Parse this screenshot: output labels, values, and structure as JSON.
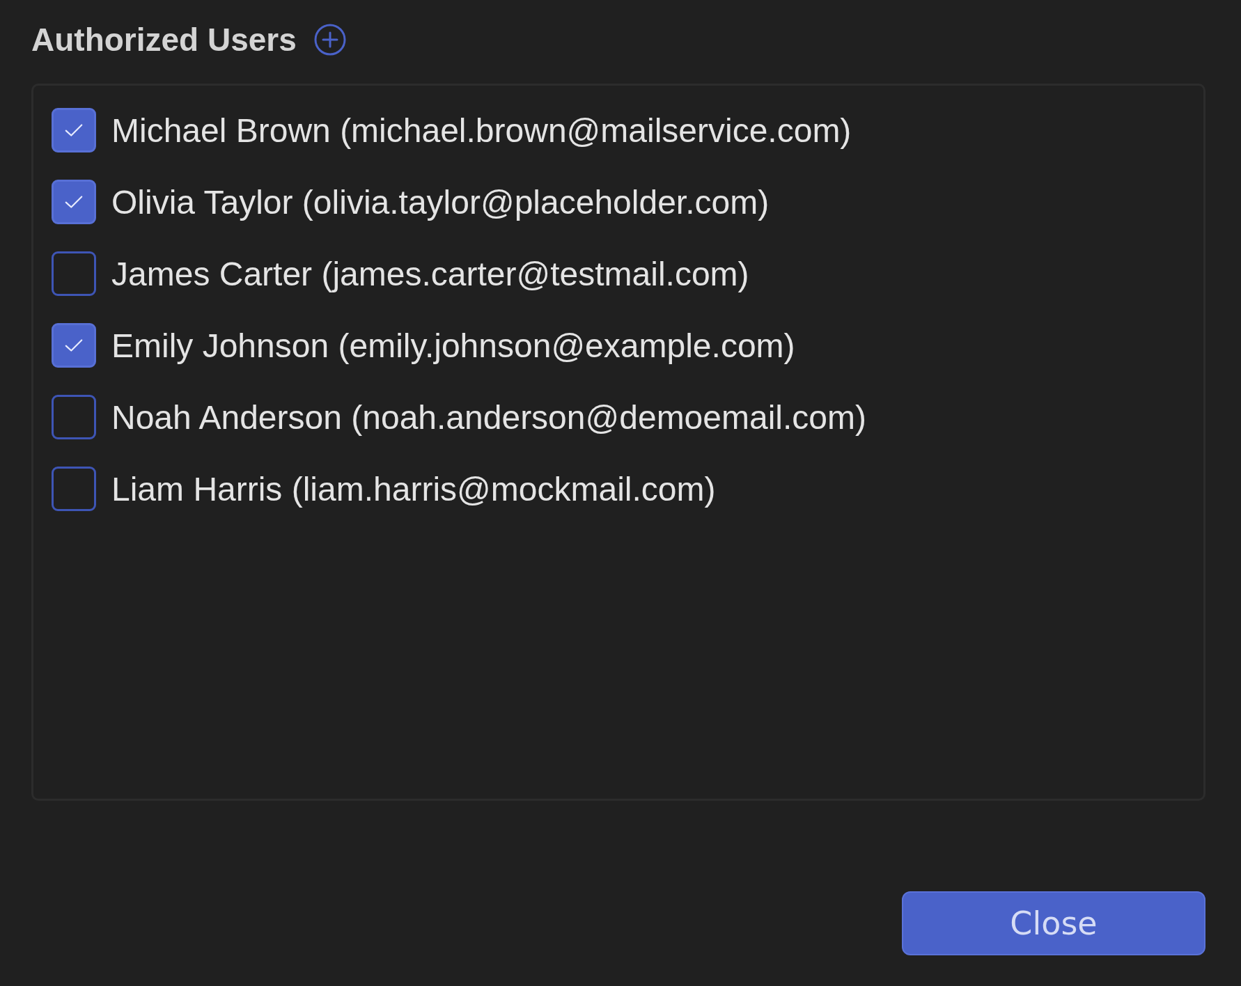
{
  "header": {
    "title": "Authorized Users"
  },
  "users": [
    {
      "label": "Michael Brown (michael.brown@mailservice.com)",
      "checked": true
    },
    {
      "label": "Olivia Taylor (olivia.taylor@placeholder.com)",
      "checked": true
    },
    {
      "label": "James Carter (james.carter@testmail.com)",
      "checked": false
    },
    {
      "label": "Emily Johnson (emily.johnson@example.com)",
      "checked": true
    },
    {
      "label": "Noah Anderson (noah.anderson@demoemail.com)",
      "checked": false
    },
    {
      "label": "Liam Harris (liam.harris@mockmail.com)",
      "checked": false
    }
  ],
  "buttons": [
    {
      "label": "Close"
    }
  ]
}
